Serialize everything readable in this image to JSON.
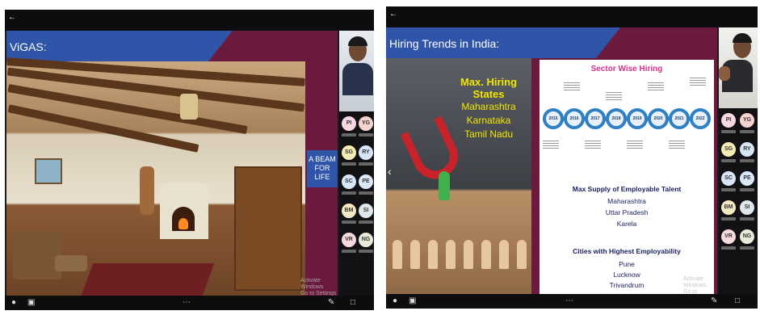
{
  "screenshot_left": {
    "slide_title": "ViGAS:",
    "caption": "A BEAM FOR LIFE",
    "watermark_line1": "Activate Windows",
    "watermark_line2": "Go to Settings to activate",
    "avatars": [
      {
        "initials": "PI",
        "color": "#f6d7e2"
      },
      {
        "initials": "YG",
        "color": "#f7d3cf"
      },
      {
        "initials": "SG",
        "color": "#f5edb5"
      },
      {
        "initials": "RY",
        "color": "#d6e6f7"
      },
      {
        "initials": "SC",
        "color": "#d7e6f8"
      },
      {
        "initials": "PE",
        "color": "#dbe8f7"
      },
      {
        "initials": "BM",
        "color": "#f5e9c4"
      },
      {
        "initials": "SI",
        "color": "#e0e7ec"
      },
      {
        "initials": "VR",
        "color": "#f7d9de"
      },
      {
        "initials": "NG",
        "color": "#e6ecd7"
      }
    ]
  },
  "screenshot_right": {
    "slide_title": "Hiring Trends in India:",
    "states_title": "Max. Hiring States",
    "states": [
      "Maharashtra",
      "Karnataka",
      "Tamil Nadu"
    ],
    "sector_title": "Sector Wise Hiring",
    "years": [
      "2015",
      "2016",
      "2017",
      "2018",
      "2019",
      "2020",
      "2021",
      "2022"
    ],
    "talent_title": "Max Supply of Employable Talent",
    "talent": [
      "Maharashtra",
      "Uttar Pradesh",
      "Karela"
    ],
    "cities_title": "Cities with Highest Employability",
    "cities": [
      "Pune",
      "Lucknow",
      "Trivandrum"
    ],
    "watermark_line1": "Activate Windows",
    "watermark_line2": "Go to Settings to activate",
    "avatars": [
      {
        "initials": "PI",
        "color": "#f6d7e2"
      },
      {
        "initials": "YG",
        "color": "#f7d3cf"
      },
      {
        "initials": "SG",
        "color": "#f5edb5"
      },
      {
        "initials": "RY",
        "color": "#d6e6f7"
      },
      {
        "initials": "SC",
        "color": "#d7e6f8"
      },
      {
        "initials": "PE",
        "color": "#dbe8f7"
      },
      {
        "initials": "BM",
        "color": "#f5e9c4"
      },
      {
        "initials": "SI",
        "color": "#e0e7ec"
      },
      {
        "initials": "VR",
        "color": "#f7d9de"
      },
      {
        "initials": "NG",
        "color": "#e6ecd7"
      }
    ]
  },
  "icons": {
    "back": "back-arrow-icon",
    "prev": "chevron-left-icon",
    "pen": "pen-icon",
    "chat": "chat-icon",
    "more": "more-icon"
  },
  "colors": {
    "slide_background": "#6b1a3e",
    "title_band": "#2e55a8",
    "state_text": "#f2e600",
    "sector_title": "#d1338a"
  }
}
